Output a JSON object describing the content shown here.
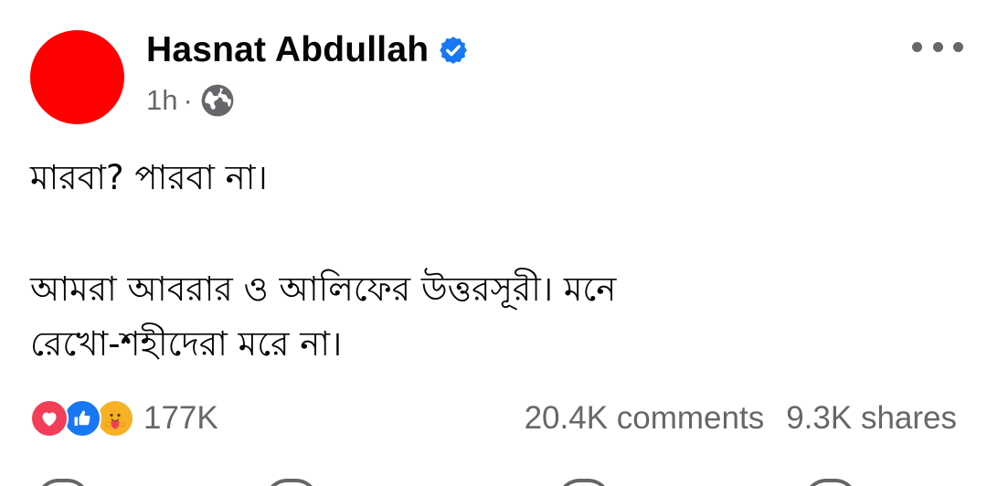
{
  "post": {
    "author": {
      "name": "Hasnat Abdullah",
      "avatar_color": "#ff0000",
      "verified_icon": "verified-badge-icon",
      "verified_color": "#1877f2"
    },
    "meta": {
      "time": "1h",
      "separator": "·",
      "audience_icon": "globe-icon"
    },
    "more_icon": "more-horizontal-icon",
    "text": {
      "line1": "মারবা? পারবা না।",
      "line2": "আমরা আবরার ও আলিফের উত্তরসূরী। মনে",
      "line3": "রেখো-শহীদেরা মরে না।"
    },
    "stats": {
      "reactions": [
        "love-reaction-icon",
        "like-reaction-icon",
        "care-reaction-icon"
      ],
      "reaction_count": "177K",
      "comments": "20.4K comments",
      "shares": "9.3K shares"
    }
  },
  "colors": {
    "text_primary": "#050505",
    "text_secondary": "#65676b",
    "love": "#f33e58",
    "like": "#1877f2",
    "care": "#f7b125"
  }
}
